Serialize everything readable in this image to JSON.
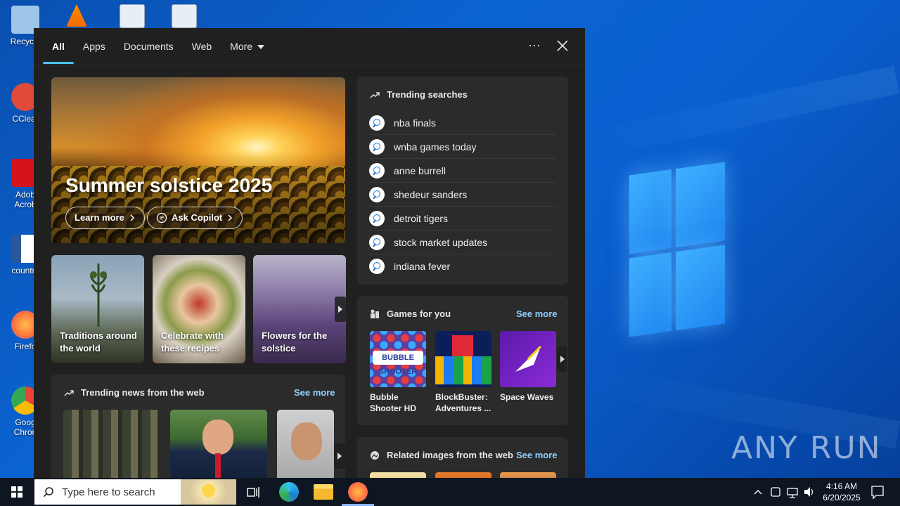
{
  "desktop": {
    "icons": [
      {
        "label": "Recycle",
        "color": "#9ec6e8"
      },
      {
        "label": "CClear",
        "color": "#e04a3a"
      },
      {
        "label": "Adob Acrob",
        "color": "#d4131b"
      },
      {
        "label": "country",
        "color": "#2b579a"
      },
      {
        "label": "Firefo",
        "color": "#ff7139"
      },
      {
        "label": "Goog Chron",
        "color": "#34a853"
      }
    ],
    "watermark": "ANY RUN"
  },
  "panel": {
    "tabs": [
      "All",
      "Apps",
      "Documents",
      "Web",
      "More"
    ],
    "more_icon": "ellipsis-icon",
    "close_icon": "close-icon",
    "hero": {
      "title": "Summer solstice 2025",
      "learn_more": "Learn more",
      "ask_copilot": "Ask Copilot"
    },
    "cards": [
      {
        "caption": "Traditions around the world"
      },
      {
        "caption": "Celebrate with these recipes"
      },
      {
        "caption": "Flowers for the solstice"
      }
    ],
    "trending_news": {
      "title": "Trending news from the web",
      "see_more": "See more"
    },
    "trending_searches": {
      "title": "Trending searches",
      "items": [
        "nba finals",
        "wnba games today",
        "anne burrell",
        "shedeur sanders",
        "detroit tigers",
        "stock market updates",
        "indiana fever"
      ]
    },
    "games": {
      "title": "Games for you",
      "see_more": "See more",
      "items": [
        {
          "name": "Bubble Shooter HD"
        },
        {
          "name": "BlockBuster: Adventures ..."
        },
        {
          "name": "Space Waves"
        }
      ]
    },
    "related_images": {
      "title": "Related images from the web",
      "see_more": "See more"
    }
  },
  "taskbar": {
    "search_placeholder": "Type here to search",
    "time": "4:16 AM",
    "date": "6/20/2025"
  }
}
